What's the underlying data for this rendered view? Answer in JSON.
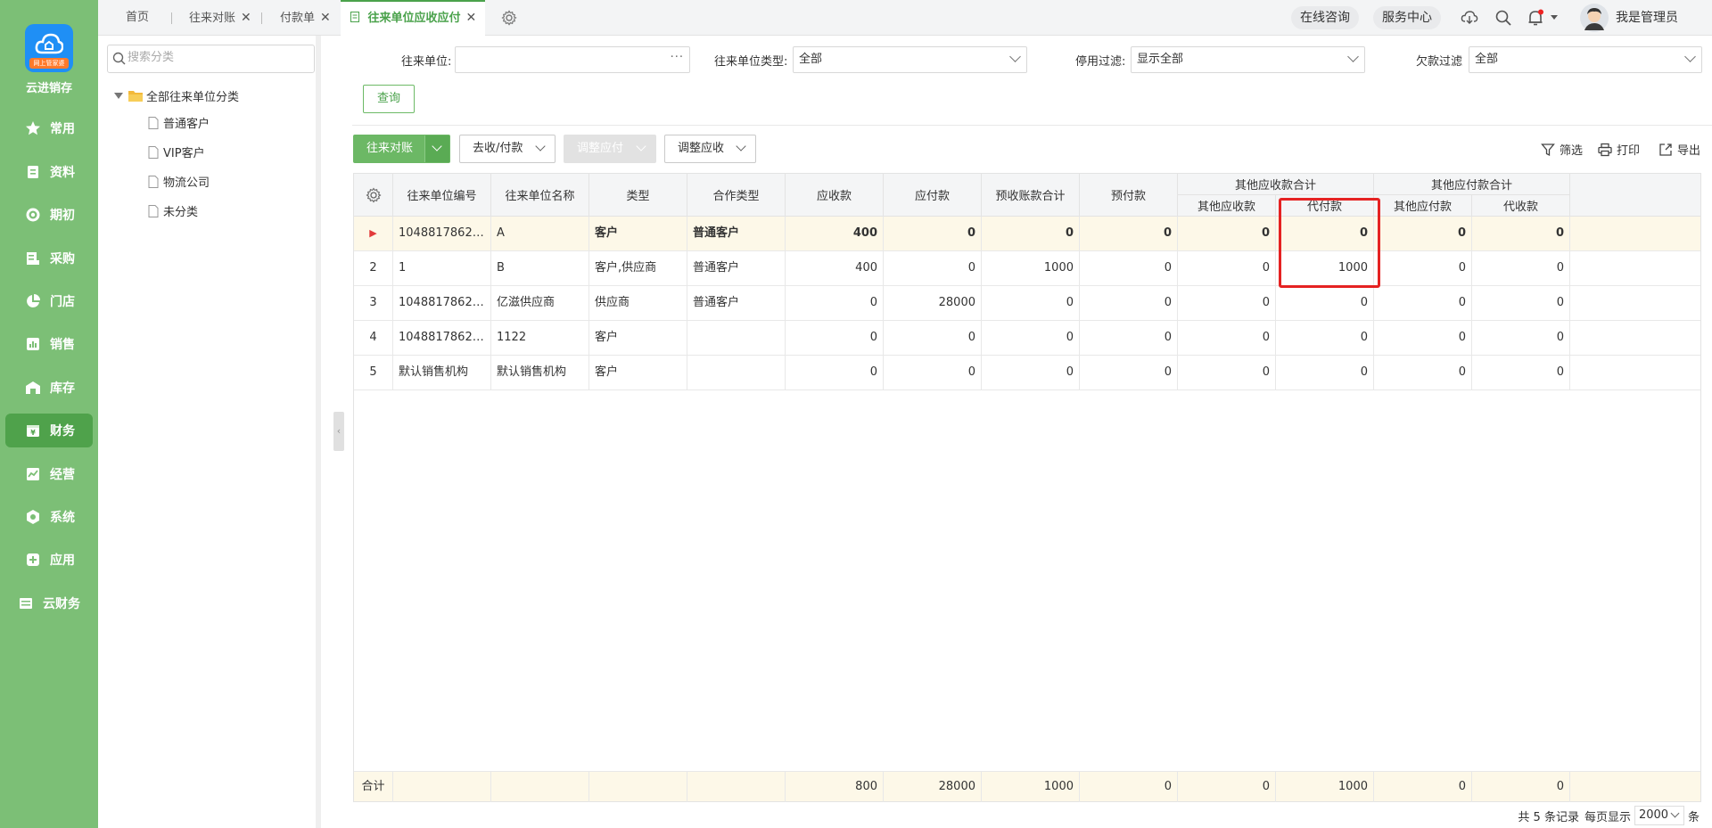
{
  "brand": {
    "name": "云进销存",
    "logo_ribbon": "网上管家婆"
  },
  "nav": [
    {
      "label": "常用",
      "icon": "star-icon"
    },
    {
      "label": "资料",
      "icon": "document-icon"
    },
    {
      "label": "期初",
      "icon": "target-icon"
    },
    {
      "label": "采购",
      "icon": "purchase-icon"
    },
    {
      "label": "门店",
      "icon": "pie-icon"
    },
    {
      "label": "销售",
      "icon": "chart-icon"
    },
    {
      "label": "库存",
      "icon": "warehouse-icon"
    },
    {
      "label": "财务",
      "icon": "finance-icon",
      "active": true
    },
    {
      "label": "经营",
      "icon": "trend-icon"
    },
    {
      "label": "系统",
      "icon": "hexagon-icon"
    },
    {
      "label": "应用",
      "icon": "plus-square-icon"
    },
    {
      "label": "云财务",
      "icon": "ledger-icon"
    }
  ],
  "tabs": [
    {
      "label": "首页"
    },
    {
      "label": "往来对账"
    },
    {
      "label": "付款单"
    },
    {
      "label": "往来单位应收应付",
      "active": true
    }
  ],
  "topbar": {
    "consult": "在线咨询",
    "service": "服务中心",
    "user": "我是管理员"
  },
  "category": {
    "search_placeholder": "搜索分类",
    "root": "全部往来单位分类",
    "children": [
      "普通客户",
      "VIP客户",
      "物流公司",
      "未分类"
    ]
  },
  "filters": {
    "unit_label": "往来单位:",
    "unit_value": "",
    "type_label": "往来单位类型:",
    "type_value": "全部",
    "disable_label": "停用过滤:",
    "disable_value": "显示全部",
    "debt_label": "欠款过滤",
    "debt_value": "全部",
    "query_button": "查询"
  },
  "toolbar": {
    "reconcile": "往来对账",
    "collect_pay": "去收/付款",
    "adjust_payable": "调整应付",
    "adjust_receivable": "调整应收",
    "filter": "筛选",
    "print": "打印",
    "export": "导出"
  },
  "grid": {
    "headers": {
      "code": "往来单位编号",
      "name": "往来单位名称",
      "type": "类型",
      "coop": "合作类型",
      "receivable": "应收款",
      "payable": "应付款",
      "prereceive": "预收账款合计",
      "prepay": "预付款",
      "other_recv_group": "其他应收款合计",
      "other_recv": "其他应收款",
      "proxy_pay": "代付款",
      "other_pay_group": "其他应付款合计",
      "other_pay": "其他应付款",
      "proxy_recv": "代收款"
    },
    "rows": [
      {
        "idx": "▶",
        "code": "10488178624...",
        "name": "A",
        "type": "客户",
        "coop": "普通客户",
        "receivable": "400",
        "payable": "0",
        "prereceive": "0",
        "prepay": "0",
        "other_recv": "0",
        "proxy_pay": "0",
        "other_pay": "0",
        "proxy_recv": "0"
      },
      {
        "idx": "2",
        "code": "1",
        "name": "B",
        "type": "客户,供应商",
        "coop": "普通客户",
        "receivable": "400",
        "payable": "0",
        "prereceive": "1000",
        "prepay": "0",
        "other_recv": "0",
        "proxy_pay": "1000",
        "other_pay": "0",
        "proxy_recv": "0"
      },
      {
        "idx": "3",
        "code": "10488178624...",
        "name": "亿滋供应商",
        "type": "供应商",
        "coop": "普通客户",
        "receivable": "0",
        "payable": "28000",
        "prereceive": "0",
        "prepay": "0",
        "other_recv": "0",
        "proxy_pay": "0",
        "other_pay": "0",
        "proxy_recv": "0"
      },
      {
        "idx": "4",
        "code": "10488178624...",
        "name": "1122",
        "type": "客户",
        "coop": "",
        "receivable": "0",
        "payable": "0",
        "prereceive": "0",
        "prepay": "0",
        "other_recv": "0",
        "proxy_pay": "0",
        "other_pay": "0",
        "proxy_recv": "0"
      },
      {
        "idx": "5",
        "code": "默认销售机构",
        "name": "默认销售机构",
        "type": "客户",
        "coop": "",
        "receivable": "0",
        "payable": "0",
        "prereceive": "0",
        "prepay": "0",
        "other_recv": "0",
        "proxy_pay": "0",
        "other_pay": "0",
        "proxy_recv": "0"
      }
    ],
    "totals": {
      "label": "合计",
      "receivable": "800",
      "payable": "28000",
      "prereceive": "1000",
      "prepay": "0",
      "other_recv": "0",
      "proxy_pay": "1000",
      "other_pay": "0",
      "proxy_recv": "0"
    }
  },
  "pager": {
    "summary": "共 5 条记录",
    "per_page_label": "每页显示",
    "per_page": "2000",
    "unit": "条"
  },
  "colors": {
    "nav_bg": "#7cbf76",
    "nav_active": "#4fa24b",
    "accent": "#4aa24b",
    "highlight": "#e52222"
  }
}
